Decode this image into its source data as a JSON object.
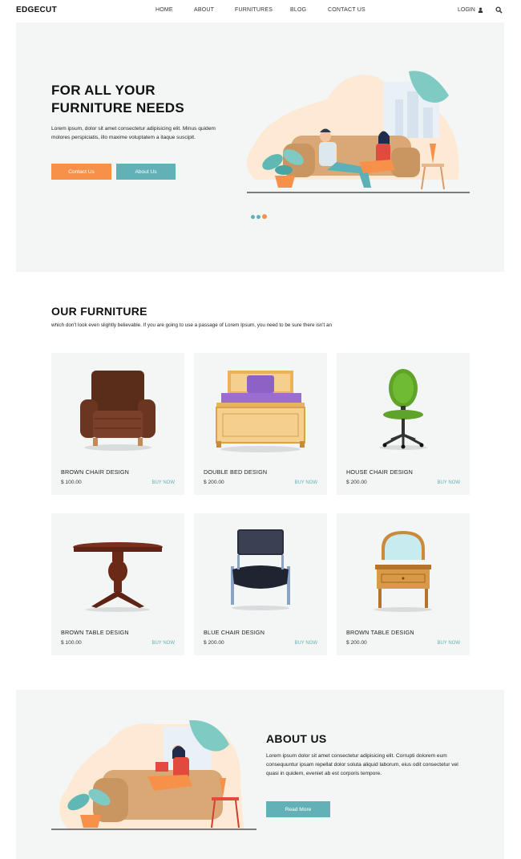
{
  "header": {
    "brand": "EDGECUT",
    "nav": [
      "HOME",
      "ABOUT",
      "FURNITURES",
      "BLOG",
      "CONTACT US"
    ],
    "login": "LOGIN"
  },
  "hero": {
    "title_line1": "FOR ALL YOUR",
    "title_line2": "FURNITURE NEEDS",
    "text": "Lorem ipsum, dolor sit amet consectetur adipisicing elit. Minus quidem molores perspiciatis, illo maxime voluptatem a itaque suscipit.",
    "contact_button": "Contact Us",
    "about_button": "About Us"
  },
  "furniture": {
    "title": "OUR FURNITURE",
    "subtitle": "which don't look even slightly believable. If you are going to use a passage of Lorem Ipsum, you need to be sure there isn't an",
    "items": [
      {
        "name": "BROWN CHAIR DESIGN",
        "price": "$ 100.00",
        "buy": "BUY NOW"
      },
      {
        "name": "DOUBLE BED DESIGN",
        "price": "$ 200.00",
        "buy": "BUY NOW"
      },
      {
        "name": "HOUSE CHAIR DESIGN",
        "price": "$ 200.00",
        "buy": "BUY NOW"
      },
      {
        "name": "BROWN TABLE DESIGN",
        "price": "$ 100.00",
        "buy": "BUY NOW"
      },
      {
        "name": "BLUE CHAIR DESIGN",
        "price": "$ 200.00",
        "buy": "BUY NOW"
      },
      {
        "name": "BROWN TABLE DESIGN",
        "price": "$ 200.00",
        "buy": "BUY NOW"
      }
    ]
  },
  "about": {
    "title": "ABOUT US",
    "text": "Lorem ipsum dolor sit amet consectetur adipisicing elit. Corrupti dolorem eum consequuntur ipsam repellat dolor soluta aliquid laborum, eius odit consectetur vel quasi in quidem, eveniet ab est corporis tempore.",
    "read_more": "Read More"
  },
  "colors": {
    "accent_orange": "#f7914a",
    "accent_teal": "#62b1b7",
    "panel_bg": "#f4f6f6"
  }
}
